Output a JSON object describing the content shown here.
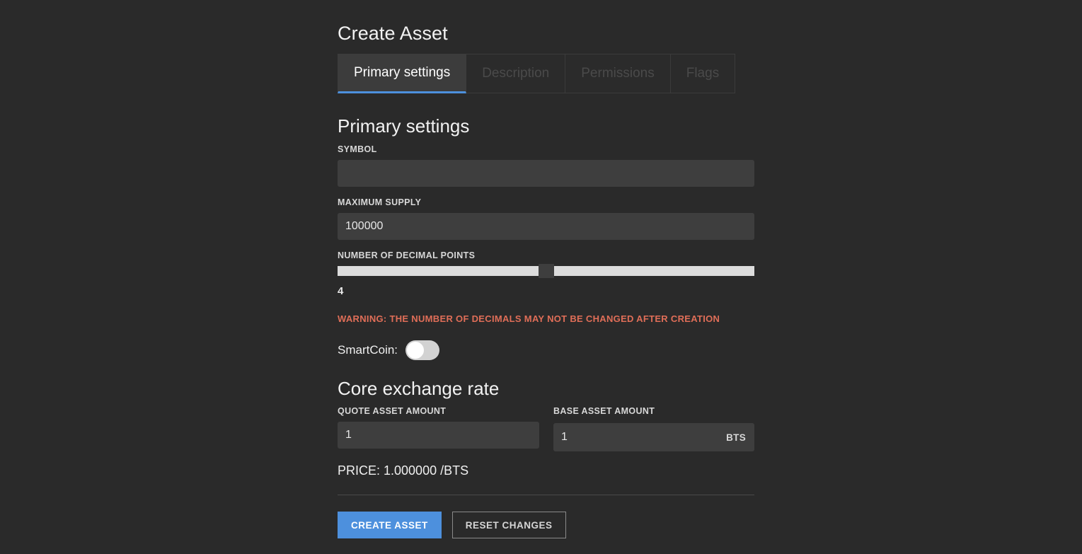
{
  "page": {
    "title": "Create Asset"
  },
  "tabs": [
    {
      "label": "Primary settings",
      "active": true
    },
    {
      "label": "Description",
      "active": false
    },
    {
      "label": "Permissions",
      "active": false
    },
    {
      "label": "Flags",
      "active": false
    }
  ],
  "primary_settings": {
    "heading": "Primary settings",
    "symbol": {
      "label": "SYMBOL",
      "value": "",
      "placeholder": ""
    },
    "maximum_supply": {
      "label": "MAXIMUM SUPPLY",
      "value": "100000"
    },
    "decimal_points": {
      "label": "NUMBER OF DECIMAL POINTS",
      "value": "4",
      "min": 0,
      "max": 8,
      "percent": 50
    },
    "warning": "WARNING: THE NUMBER OF DECIMALS MAY NOT BE CHANGED AFTER CREATION",
    "smartcoin": {
      "label": "SmartCoin:",
      "enabled": false
    }
  },
  "core_exchange_rate": {
    "heading": "Core exchange rate",
    "quote": {
      "label": "QUOTE ASSET AMOUNT",
      "value": "1"
    },
    "base": {
      "label": "BASE ASSET AMOUNT",
      "value": "1",
      "suffix": "BTS"
    },
    "price_line": "PRICE: 1.000000 /BTS"
  },
  "actions": {
    "create_label": "CREATE ASSET",
    "reset_label": "RESET CHANGES"
  },
  "colors": {
    "background": "#2a2a2a",
    "input_background": "#3e3e3e",
    "accent_blue": "#4d90dd",
    "warning_red": "#e06e58",
    "slider_track": "#dcdcdc",
    "active_tab_background": "#3c3c3c"
  }
}
